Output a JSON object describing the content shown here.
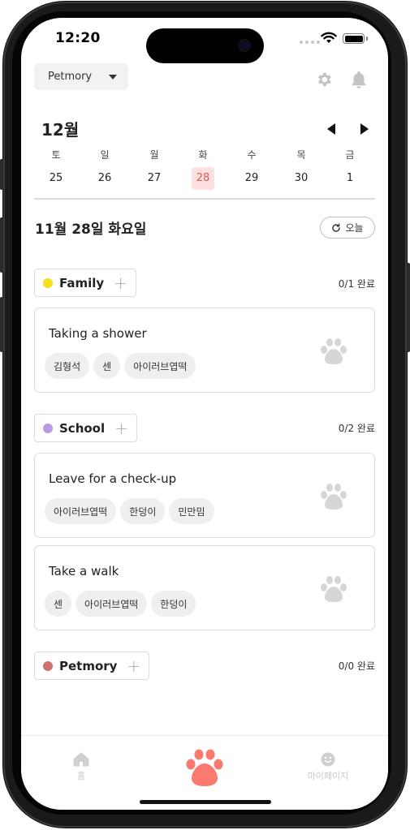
{
  "status_bar": {
    "time": "12:20"
  },
  "header": {
    "pet_selector": "Petmory"
  },
  "calendar": {
    "month_label": "12월",
    "weekdays": [
      "토",
      "일",
      "월",
      "화",
      "수",
      "목",
      "금"
    ],
    "days": [
      "25",
      "26",
      "27",
      "28",
      "29",
      "30",
      "1"
    ],
    "selected_index": 3
  },
  "date_title": "11월 28일 화요일",
  "today_button": "오늘",
  "groups": [
    {
      "name": "Family",
      "color": "#f7e01b",
      "progress": "0/1 완료",
      "tasks": [
        {
          "title": "Taking a shower",
          "tags": [
            "김형석",
            "센",
            "아이러브엽떡"
          ]
        }
      ]
    },
    {
      "name": "School",
      "color": "#b79be6",
      "progress": "0/2 완료",
      "tasks": [
        {
          "title": "Leave for a check-up",
          "tags": [
            "아이러브엽떡",
            "한덩이",
            "민만밈"
          ]
        },
        {
          "title": "Take a walk",
          "tags": [
            "센",
            "아이러브엽떡",
            "한덩이"
          ]
        }
      ]
    },
    {
      "name": "Petmory",
      "color": "#d06f6f",
      "progress": "0/0 완료",
      "tasks": []
    }
  ],
  "tabbar": {
    "home_label": "홈",
    "mypage_label": "마이페이지"
  },
  "colors": {
    "accent": "#fa7a6f",
    "selected_day_bg": "#fde0df",
    "selected_day_text": "#e8574e",
    "paw_gray": "#d6d6d6"
  }
}
